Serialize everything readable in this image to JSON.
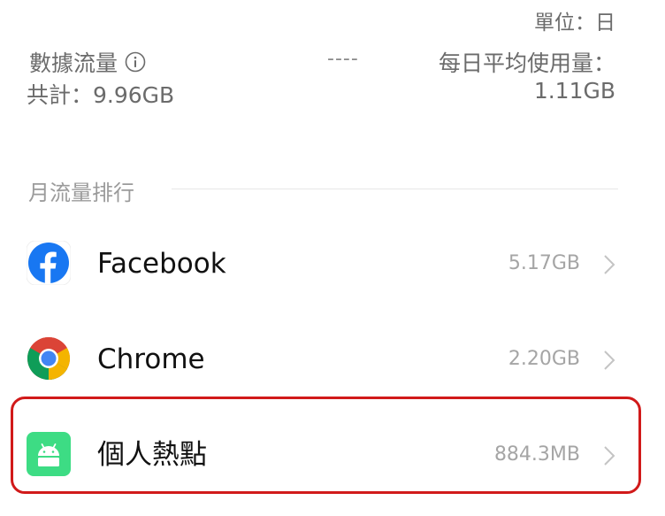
{
  "header": {
    "unit": "單位：日",
    "data_usage_label": "數據流量",
    "dashes": "----",
    "total": "共計：9.96GB",
    "avg_label": "每日平均使用量：",
    "avg_value": "1.11GB"
  },
  "ranking": {
    "title": "月流量排行",
    "apps": [
      {
        "name": "Facebook",
        "usage": "5.17GB",
        "icon": "facebook-icon"
      },
      {
        "name": "Chrome",
        "usage": "2.20GB",
        "icon": "chrome-icon"
      },
      {
        "name": "個人熱點",
        "usage": "884.3MB",
        "icon": "android-icon"
      }
    ]
  },
  "colors": {
    "facebook": "#1877F2",
    "chrome_red": "#DB4437",
    "chrome_yellow": "#F4B400",
    "chrome_green": "#0F9D58",
    "chrome_blue": "#4285F4",
    "android_tile": "#3DDC84",
    "highlight": "#D11A1A"
  }
}
